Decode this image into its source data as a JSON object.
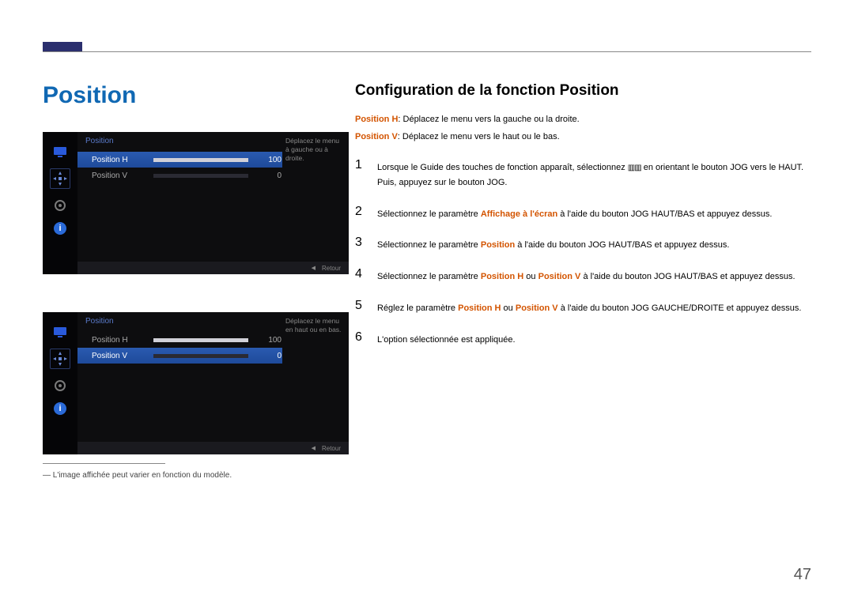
{
  "page_title": "Position",
  "section_heading": "Configuration de la fonction Position",
  "definitions": {
    "posH_label": "Position H",
    "posH_text": ": Déplacez le menu vers la gauche ou la droite.",
    "posV_label": "Position V",
    "posV_text": ": Déplacez le menu vers le haut ou le bas."
  },
  "steps": [
    {
      "num": "1",
      "pre": "Lorsque le Guide des touches de fonction apparaît, sélectionnez ",
      "glyph": "▥▥",
      "post": " en orientant le bouton JOG vers le HAUT. Puis, appuyez sur le bouton JOG."
    },
    {
      "num": "2",
      "pre": "Sélectionnez le paramètre ",
      "hl": "Affichage à l'écran",
      "post": " à l'aide du bouton JOG HAUT/BAS et appuyez dessus."
    },
    {
      "num": "3",
      "pre": "Sélectionnez le paramètre ",
      "hl": "Position",
      "post": " à l'aide du bouton JOG HAUT/BAS et appuyez dessus."
    },
    {
      "num": "4",
      "pre": "Sélectionnez le paramètre ",
      "hl": "Position H",
      "mid": " ou ",
      "hl2": "Position V",
      "post": " à l'aide du bouton JOG HAUT/BAS et appuyez dessus."
    },
    {
      "num": "5",
      "pre": "Réglez le paramètre ",
      "hl": "Position H",
      "mid": " ou ",
      "hl2": "Position V",
      "post": " à l'aide du bouton JOG GAUCHE/DROITE et appuyez dessus."
    },
    {
      "num": "6",
      "pre": "L'option sélectionnée est appliquée."
    }
  ],
  "osd": {
    "title": "Position",
    "rows": [
      {
        "label": "Position H",
        "value": "100",
        "fill": 100
      },
      {
        "label": "Position V",
        "value": "0",
        "fill": 0
      }
    ],
    "hint1": "Déplacez le menu à gauche ou à droite.",
    "hint2": "Déplacez le menu en haut ou en bas.",
    "footer_back": "Retour"
  },
  "footnote": "― L'image affichée peut varier en fonction du modèle.",
  "page_number": "47"
}
